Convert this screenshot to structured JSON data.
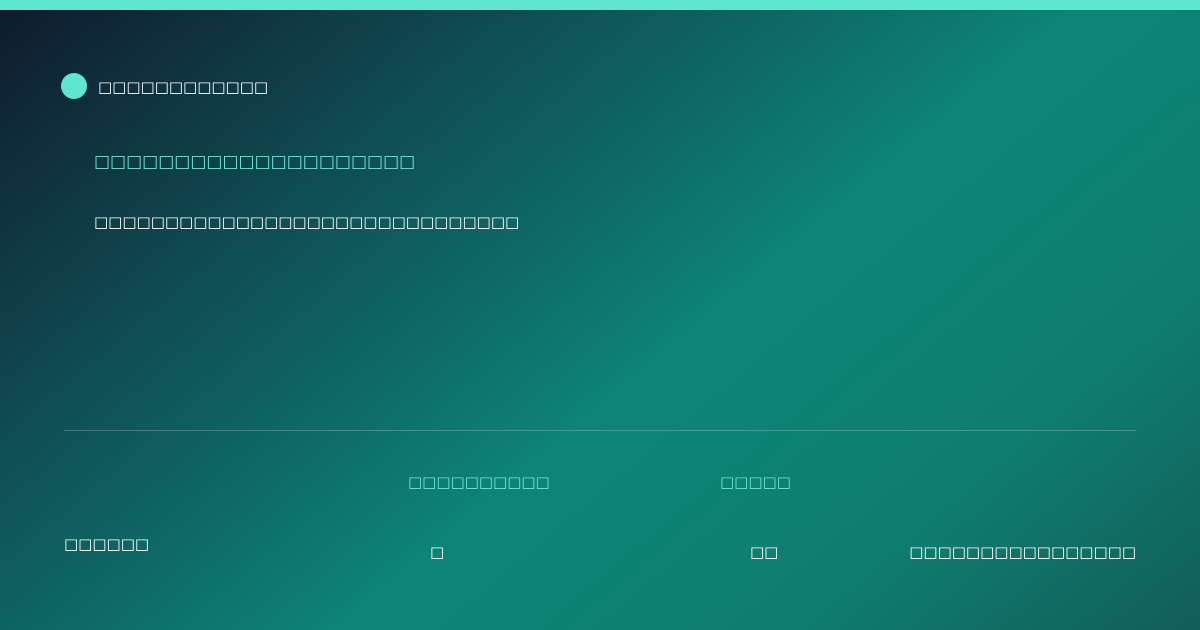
{
  "brand": {
    "name": "□□□□□□□□□□□□",
    "accent_color": "#5ee6d0"
  },
  "hero": {
    "headline": "□□□□□□□□□□□□□□□□□□□□",
    "subtitle": "□□□□□□□□□□□□□□□□□□□□□□□□□□□□□□"
  },
  "footer": {
    "left_text": "□□□□□□",
    "stat_a": {
      "label": "□□□□□□□□□□",
      "value": "□"
    },
    "stat_b": {
      "label": "□□□□□",
      "value": "□□"
    },
    "right_text": "□□□□□□□□□□□□□□□□"
  }
}
